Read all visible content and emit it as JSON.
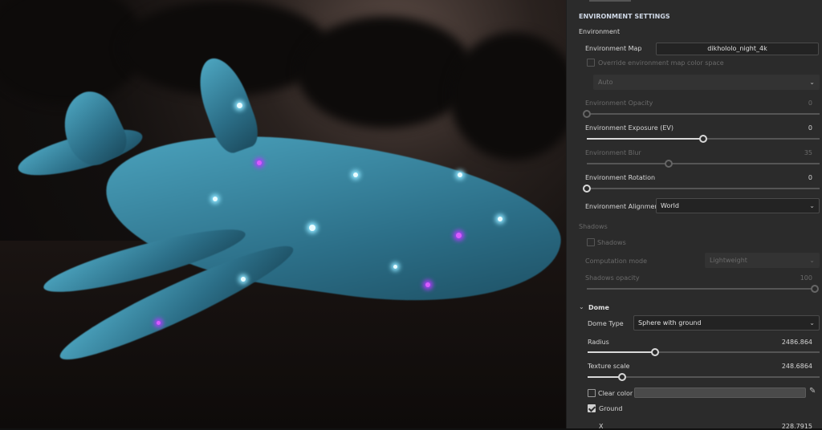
{
  "panel": {
    "title": "ENVIRONMENT SETTINGS",
    "environment": {
      "section": "Environment",
      "map_label": "Environment Map",
      "map_value": "dikhololo_night_4k",
      "override_label": "Override environment map color space",
      "override_checked": false,
      "color_space": "Auto",
      "opacity": {
        "label": "Environment Opacity",
        "value": "0",
        "fraction": 0
      },
      "exposure": {
        "label": "Environment Exposure (EV)",
        "value": "0",
        "fraction": 0.5
      },
      "blur": {
        "label": "Environment Blur",
        "value": "35",
        "fraction": 0.35
      },
      "rotation": {
        "label": "Environment Rotation",
        "value": "0",
        "fraction": 0
      },
      "alignment_label": "Environment Alignment",
      "alignment_value": "World"
    },
    "shadows": {
      "section": "Shadows",
      "checkbox_label": "Shadows",
      "checked": false,
      "mode_label": "Computation mode",
      "mode_value": "Lightweight",
      "opacity": {
        "label": "Shadows opacity",
        "value": "100",
        "fraction": 1
      }
    },
    "dome": {
      "section": "Dome",
      "type_label": "Dome Type",
      "type_value": "Sphere with ground",
      "radius": {
        "label": "Radius",
        "value": "2486.864",
        "fraction": 0.29
      },
      "texture_scale": {
        "label": "Texture scale",
        "value": "248.6864",
        "fraction": 0.15
      },
      "clear_color_label": "Clear color",
      "clear_color_checked": false,
      "clear_color": "#4a4a4a",
      "ground_label": "Ground",
      "ground_checked": true,
      "x_label": "X",
      "x_value": "228.7915"
    }
  }
}
